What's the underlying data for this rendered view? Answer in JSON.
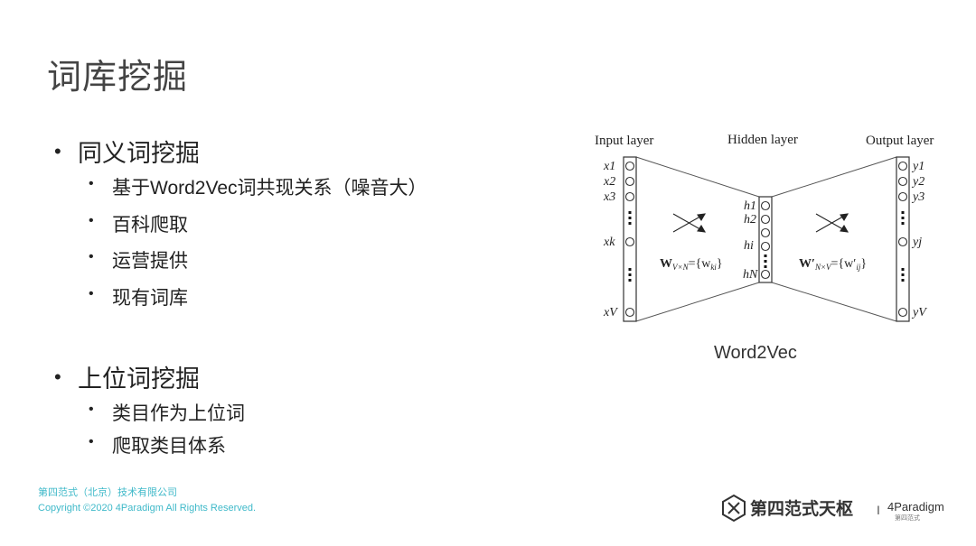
{
  "slide": {
    "title": "词库挖掘",
    "sections": [
      {
        "heading": "同义词挖掘",
        "items": [
          "基于Word2Vec词共现关系（噪音大）",
          "百科爬取",
          "运营提供",
          "现有词库"
        ]
      },
      {
        "heading": "上位词挖掘",
        "items": [
          "类目作为上位词",
          "爬取类目体系"
        ]
      }
    ]
  },
  "diagram": {
    "caption": "Word2Vec",
    "input_label": "Input layer",
    "hidden_label": "Hidden layer",
    "output_label": "Output layer",
    "input_nodes": [
      "x1",
      "x2",
      "x3",
      "xk",
      "xV"
    ],
    "hidden_nodes": [
      "h1",
      "h2",
      "hi",
      "hN"
    ],
    "output_nodes": [
      "y1",
      "y2",
      "y3",
      "yj",
      "yV"
    ],
    "w_left": "W",
    "w_left_sub": "V×N",
    "w_left_set": "={w",
    "w_left_set_sub": "ki",
    "w_right": "W′",
    "w_right_sub": "N×V",
    "w_right_set": "={w′",
    "w_right_set_sub": "ij",
    "set_close": "}"
  },
  "footer": {
    "company": "第四范式（北京）技术有限公司",
    "copyright": "Copyright ©2020 4Paradigm All Rights Reserved."
  },
  "logo": {
    "brand_cn": "第四范式天枢",
    "separator": "I",
    "brand_en": "4Paradigm",
    "brand_en_sub": "第四范式"
  },
  "colors": {
    "accent": "#3fb9c9",
    "text": "#222222",
    "title": "#444444"
  }
}
